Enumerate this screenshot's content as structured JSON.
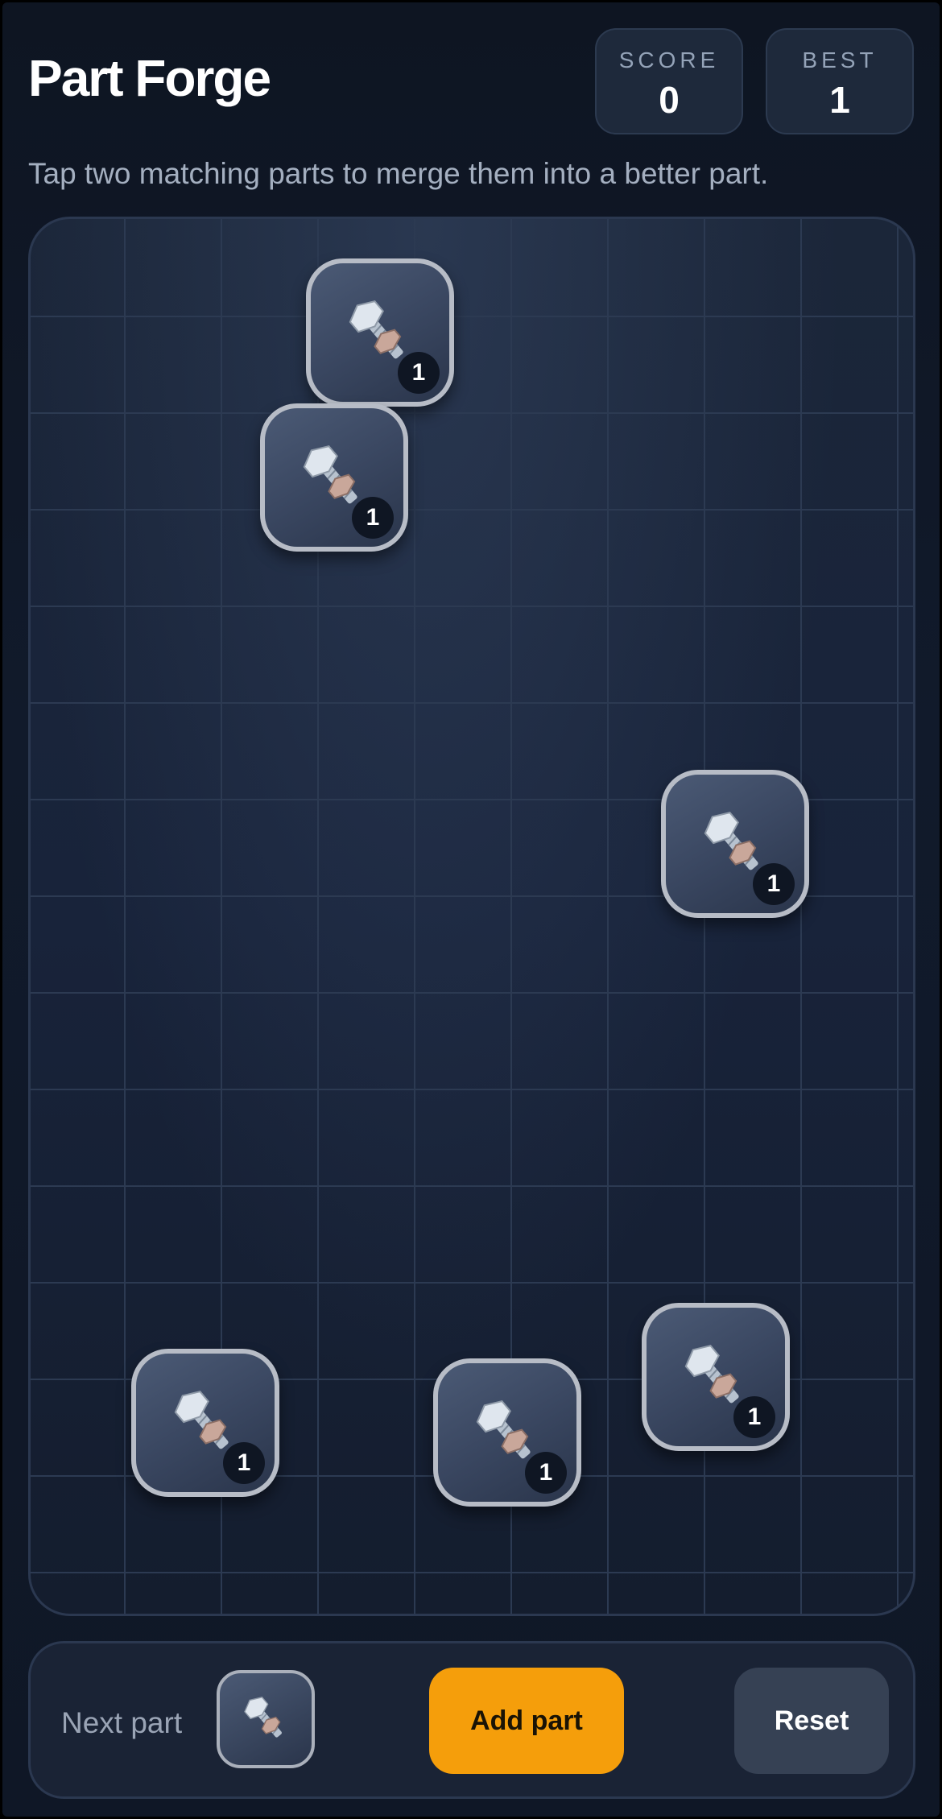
{
  "header": {
    "title": "Part Forge",
    "score_label": "SCORE",
    "score_value": "0",
    "best_label": "BEST",
    "best_value": "1",
    "hint": "Tap two matching parts to merge them into a better part."
  },
  "board": {
    "tiles": [
      {
        "icon": "bolt-and-nut-icon",
        "level": "1"
      },
      {
        "icon": "bolt-and-nut-icon",
        "level": "1"
      },
      {
        "icon": "bolt-and-nut-icon",
        "level": "1"
      },
      {
        "icon": "bolt-and-nut-icon",
        "level": "1"
      },
      {
        "icon": "bolt-and-nut-icon",
        "level": "1"
      },
      {
        "icon": "bolt-and-nut-icon",
        "level": "1"
      }
    ]
  },
  "footer": {
    "next_label": "Next part",
    "next_icon": "bolt-and-nut-icon",
    "add_label": "Add part",
    "reset_label": "Reset"
  },
  "colors": {
    "accent": "#f59e0b",
    "background": "#0f1726",
    "tile_border": "#b7bcc6"
  }
}
